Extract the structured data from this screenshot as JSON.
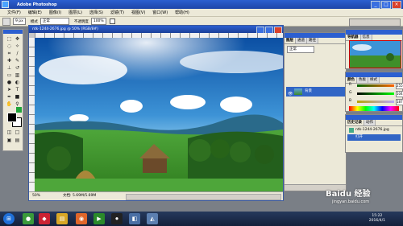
{
  "window": {
    "title": "Adobe Photoshop"
  },
  "menu": [
    "文件(F)",
    "编辑(E)",
    "图像(I)",
    "图层(L)",
    "选择(S)",
    "滤镜(T)",
    "视图(V)",
    "窗口(W)",
    "帮助(H)"
  ],
  "options": {
    "brush_size": "9 px",
    "mode_label": "模式",
    "mode_value": "正常",
    "opacity_label": "不透明度",
    "opacity_value": "100%"
  },
  "document": {
    "title": "ntk-1244-2676.jpg @ 50% (RGB/8#)",
    "zoom": "50%",
    "doc_info": "文档: 5.69M/5.69M"
  },
  "layers_panel": {
    "tabs": [
      "图层",
      "通道",
      "路径"
    ],
    "mode": "正常",
    "layer_name": "背景"
  },
  "navigator_panel": {
    "tabs": [
      "导航器",
      "信息"
    ]
  },
  "color_panel": {
    "tabs": [
      "颜色",
      "色板",
      "样式"
    ],
    "r_label": "R",
    "g_label": "G",
    "b_label": "B",
    "r_value": "255",
    "g_value": "104",
    "b_value": "187"
  },
  "history_panel": {
    "tabs": [
      "历史记录",
      "动作"
    ],
    "items": [
      "ntk-1244-2676.jpg",
      "打开"
    ]
  },
  "taskbar": {
    "time": "15:22",
    "date": "2016/4/1"
  },
  "watermark": {
    "text": "Baidu 经验",
    "url": "jingyan.baidu.com"
  },
  "colors": {
    "foreground": "#000000",
    "background": "#ffffff",
    "accent": "#2c5fd0"
  }
}
